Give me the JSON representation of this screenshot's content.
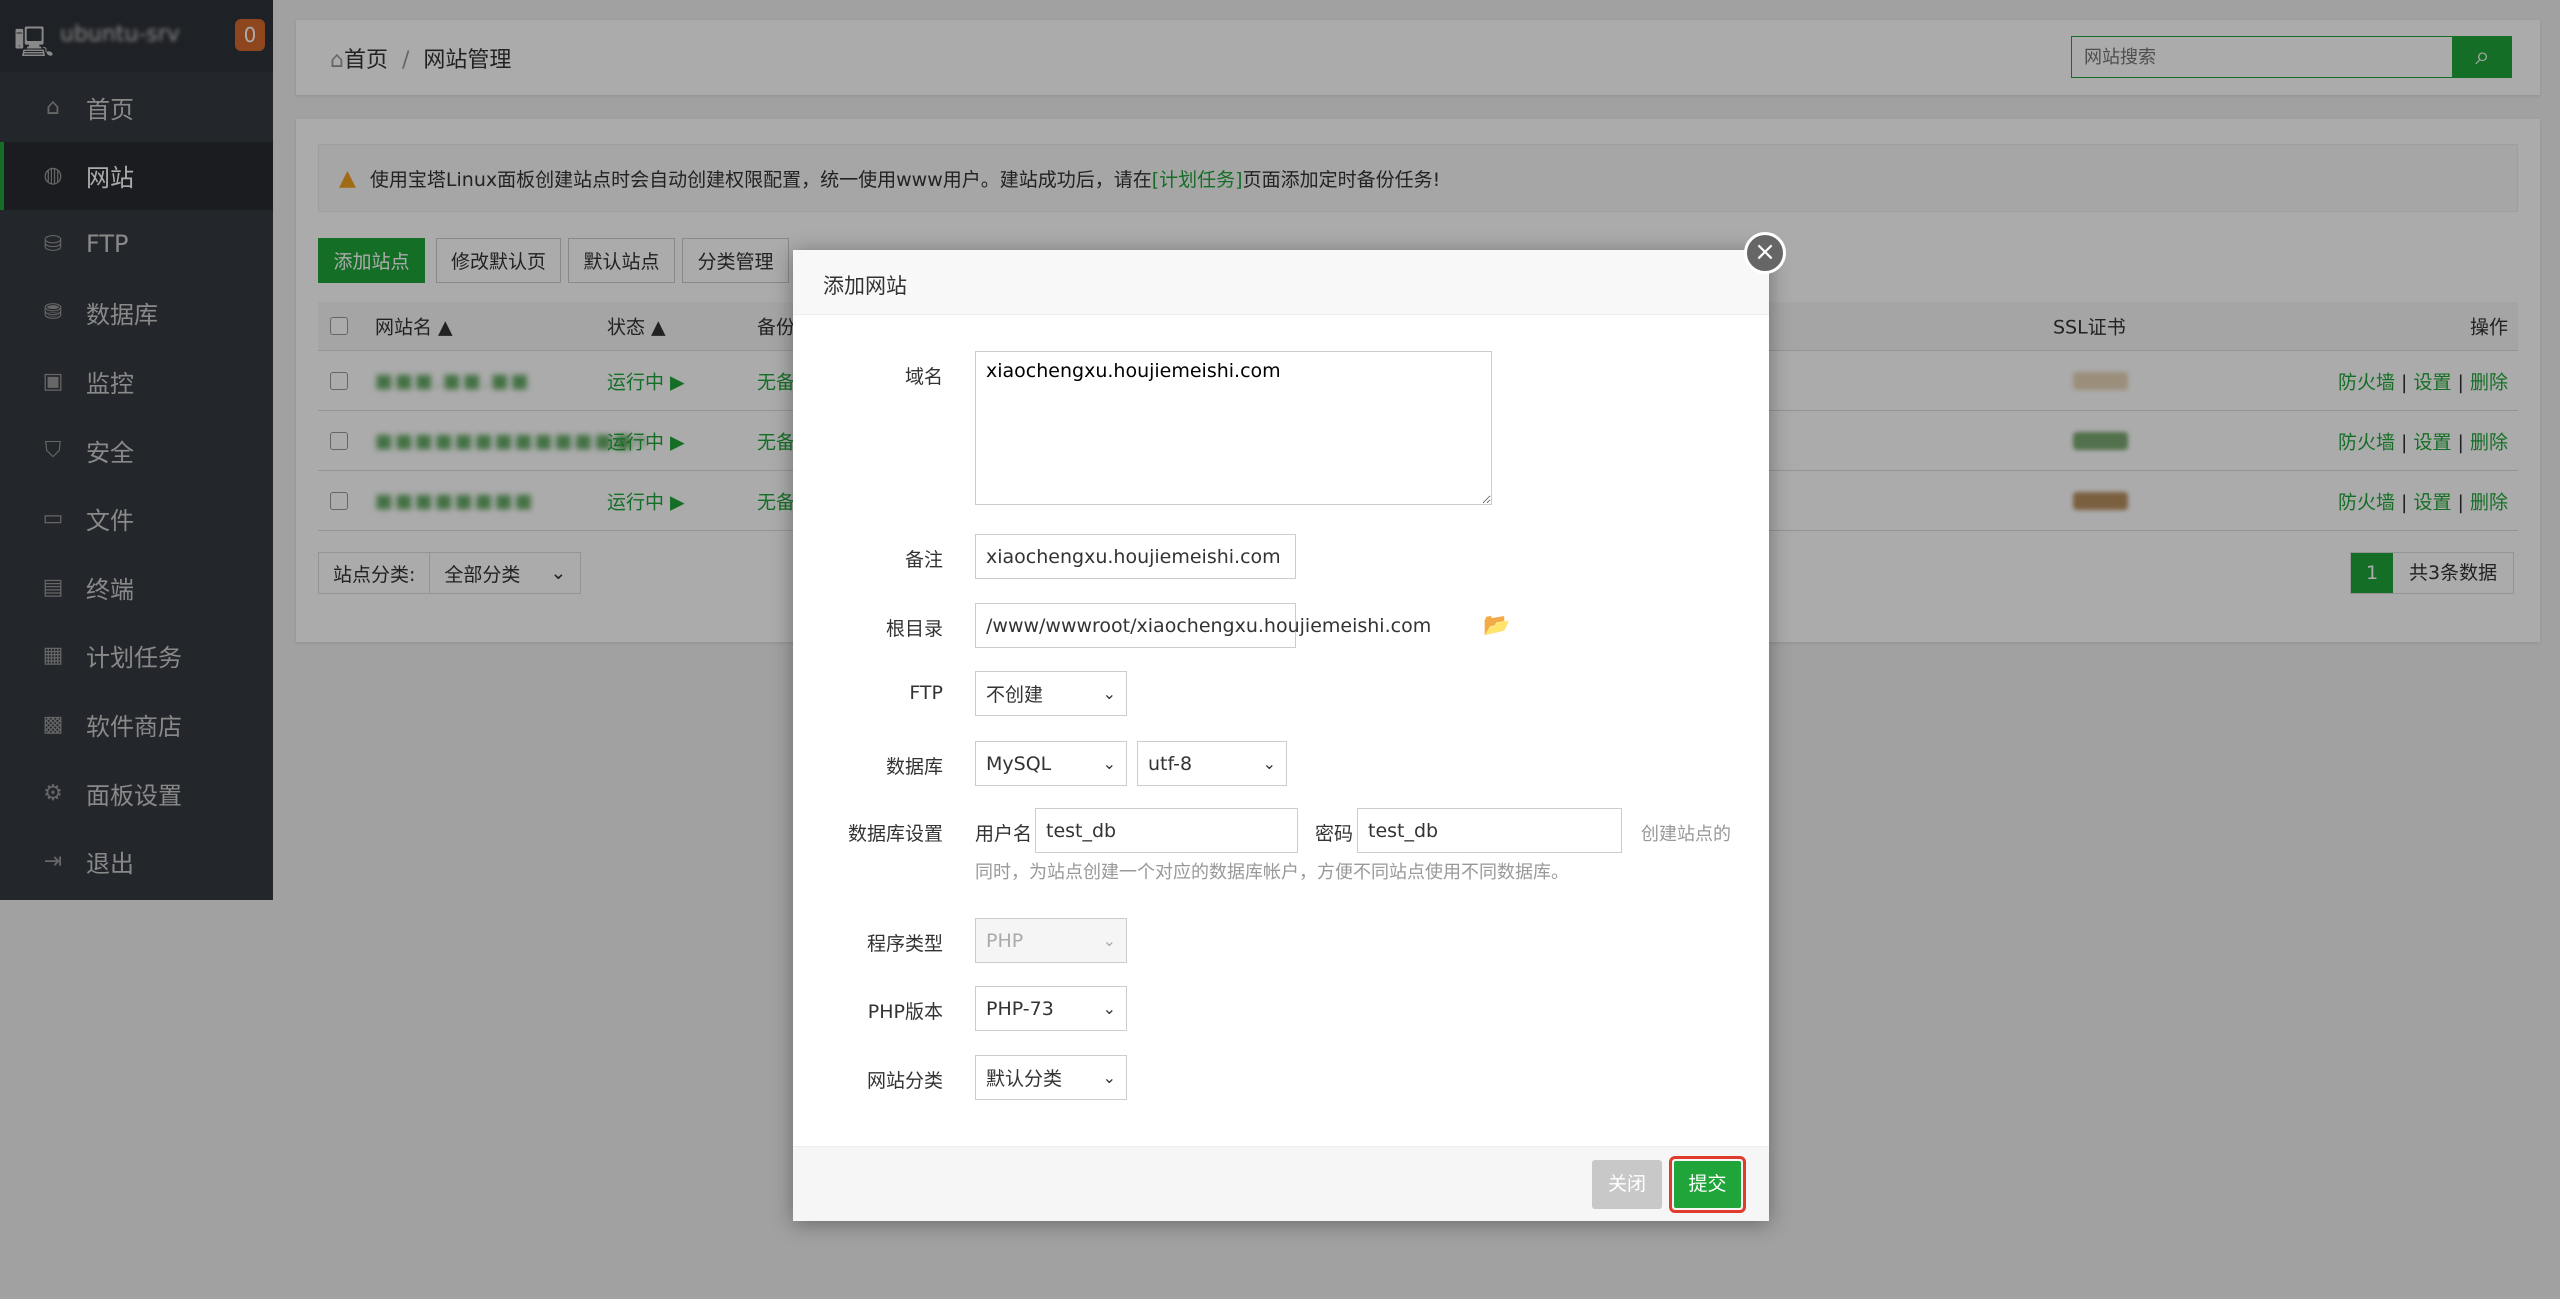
{
  "sidebar": {
    "server_name": "ubuntu-srv",
    "badge": "0",
    "items": [
      {
        "label": "首页",
        "icon": "home-icon"
      },
      {
        "label": "网站",
        "icon": "globe-icon",
        "active": true
      },
      {
        "label": "FTP",
        "icon": "ftp-icon"
      },
      {
        "label": "数据库",
        "icon": "database-icon"
      },
      {
        "label": "监控",
        "icon": "monitor-icon"
      },
      {
        "label": "安全",
        "icon": "shield-icon"
      },
      {
        "label": "文件",
        "icon": "folder-icon"
      },
      {
        "label": "终端",
        "icon": "terminal-icon"
      },
      {
        "label": "计划任务",
        "icon": "calendar-icon"
      },
      {
        "label": "软件商店",
        "icon": "apps-icon"
      },
      {
        "label": "面板设置",
        "icon": "gear-icon"
      },
      {
        "label": "退出",
        "icon": "logout-icon"
      }
    ]
  },
  "breadcrumb": {
    "home": "首页",
    "sep": "/",
    "current": "网站管理"
  },
  "search": {
    "placeholder": "网站搜索"
  },
  "notice": {
    "text1": "使用宝塔Linux面板创建站点时会自动创建权限配置，统一使用www用户。建站成功后，请在",
    "link": "[计划任务]",
    "text2": "页面添加定时备份任务!"
  },
  "toolbar": {
    "add": "添加站点",
    "edit_default": "修改默认页",
    "default_site": "默认站点",
    "category": "分类管理"
  },
  "table": {
    "headers": {
      "name": "网站名 ▲",
      "status": "状态 ▲",
      "backup": "备份",
      "ssl": "SSL证书",
      "ops": "操作"
    },
    "rows": [
      {
        "name": "■■■.■■.■■",
        "status": "运行中 ▶",
        "backup": "无备份"
      },
      {
        "name": "■■■■■■■■■■■■■n",
        "status": "运行中 ▶",
        "backup": "无备份"
      },
      {
        "name": "■■■■■■■■",
        "status": "运行中 ▶",
        "backup": "无备份"
      }
    ],
    "ops": {
      "firewall": "防火墙",
      "settings": "设置",
      "delete": "删除",
      "sep": "|"
    }
  },
  "category_filter": {
    "label": "站点分类:",
    "value": "全部分类"
  },
  "pagination": {
    "page": "1",
    "total": "共3条数据"
  },
  "modal": {
    "title": "添加网站",
    "domain": {
      "label": "域名",
      "value": "xiaochengxu.houjiemeishi.com"
    },
    "remark": {
      "label": "备注",
      "value": "xiaochengxu.houjiemeishi.com"
    },
    "root": {
      "label": "根目录",
      "value": "/www/wwwroot/xiaochengxu.houjiemeishi.com"
    },
    "ftp": {
      "label": "FTP",
      "value": "不创建"
    },
    "database": {
      "label": "数据库",
      "type": "MySQL",
      "charset": "utf-8"
    },
    "db_settings": {
      "label": "数据库设置",
      "user_label": "用户名",
      "user": "test_db",
      "pass_label": "密码",
      "pass": "test_db",
      "hint1": "创建站点的",
      "hint2": "同时，为站点创建一个对应的数据库帐户，方便不同站点使用不同数据库。"
    },
    "program": {
      "label": "程序类型",
      "value": "PHP"
    },
    "php": {
      "label": "PHP版本",
      "value": "PHP-73"
    },
    "category": {
      "label": "网站分类",
      "value": "默认分类"
    },
    "close": "关闭",
    "submit": "提交"
  },
  "colors": {
    "accent": "#20a53a",
    "badge": "#d4692e",
    "highlight": "#e03c2e"
  }
}
